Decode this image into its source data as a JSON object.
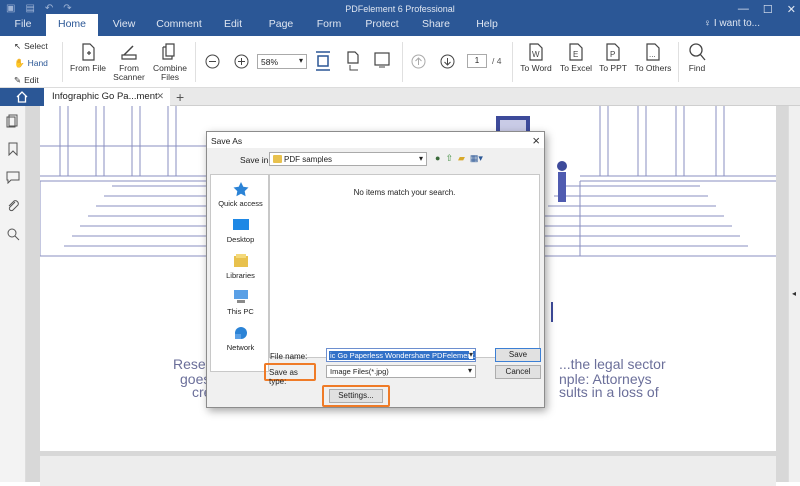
{
  "app": {
    "title": "PDFelement 6 Professional",
    "search_hint": "I want to..."
  },
  "menu": [
    "File",
    "Home",
    "View",
    "Comment",
    "Edit",
    "Page",
    "Form",
    "Protect",
    "Share",
    "Help"
  ],
  "ribbon": {
    "select_label": "Select",
    "hand_label": "Hand",
    "edit_label": "Edit",
    "from_file": "From File",
    "from_scanner_1": "From",
    "from_scanner_2": "Scanner",
    "combine_1": "Combine",
    "combine_2": "Files",
    "zoom_value": "58%",
    "page_current": "1",
    "page_total": "/ 4",
    "to_word": "To Word",
    "to_excel": "To Excel",
    "to_ppt": "To PPT",
    "to_others": "To Others",
    "find": "Find"
  },
  "tabs": {
    "doc_tab": "Infographic Go Pa...ment"
  },
  "page_text": {
    "line1_left": "Resec",
    "line1_right": "...the legal sector",
    "line2_left": "goes",
    "line2_right": "nple: Attorneys",
    "line3_left": "cre",
    "line3_right": "sults in a loss of"
  },
  "dialog": {
    "title": "Save As",
    "save_in_label": "Save in:",
    "save_in_value": "PDF samples",
    "empty_message": "No items match your search.",
    "places": [
      "Quick access",
      "Desktop",
      "Libraries",
      "This PC",
      "Network"
    ],
    "file_name_label": "File name:",
    "file_name_value": "ic Go Paperless Wondershare PDFelement.jpg",
    "save_as_type_label": "Save as type:",
    "save_as_type_value": "Image Files(*.jpg)",
    "save_button": "Save",
    "cancel_button": "Cancel",
    "settings_button": "Settings..."
  },
  "colors": {
    "brand_blue": "#2b5796",
    "highlight_orange": "#ef7b27",
    "selection_blue": "#3271c8"
  }
}
